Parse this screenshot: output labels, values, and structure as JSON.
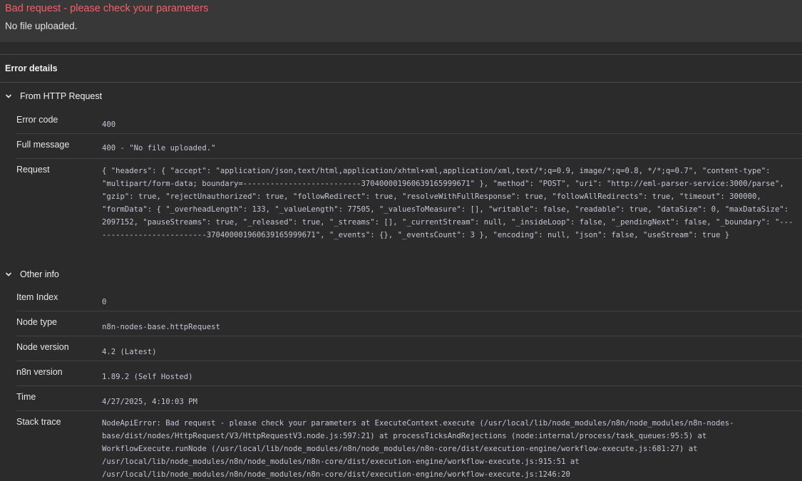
{
  "error": {
    "title": "Bad request - please check your parameters",
    "description": "No file uploaded."
  },
  "details": {
    "heading": "Error details",
    "sections": [
      {
        "title": "From HTTP Request",
        "rows": [
          {
            "label": "Error code",
            "value": "400"
          },
          {
            "label": "Full message",
            "value": "400 - \"No file uploaded.\""
          },
          {
            "label": "Request",
            "value": "{ \"headers\": { \"accept\": \"application/json,text/html,application/xhtml+xml,application/xml,text/*;q=0.9, image/*;q=0.8, */*;q=0.7\", \"content-type\": \"multipart/form-data; boundary=--------------------------370400001960639165999671\" }, \"method\": \"POST\", \"uri\": \"http://eml-parser-service:3000/parse\", \"gzip\": true, \"rejectUnauthorized\": true, \"followRedirect\": true, \"resolveWithFullResponse\": true, \"followAllRedirects\": true, \"timeout\": 300000, \"formData\": { \"_overheadLength\": 133, \"_valueLength\": 77505, \"_valuesToMeasure\": [], \"writable\": false, \"readable\": true, \"dataSize\": 0, \"maxDataSize\": 2097152, \"pauseStreams\": true, \"_released\": true, \"_streams\": [], \"_currentStream\": null, \"_insideLoop\": false, \"_pendingNext\": false, \"_boundary\": \"--------------------------370400001960639165999671\", \"_events\": {}, \"_eventsCount\": 3 }, \"encoding\": null, \"json\": false, \"useStream\": true }"
          }
        ]
      },
      {
        "title": "Other info",
        "rows": [
          {
            "label": "Item Index",
            "value": "0"
          },
          {
            "label": "Node type",
            "value": "n8n-nodes-base.httpRequest"
          },
          {
            "label": "Node version",
            "value": "4.2 (Latest)"
          },
          {
            "label": "n8n version",
            "value": "1.89.2 (Self Hosted)"
          },
          {
            "label": "Time",
            "value": "4/27/2025, 4:10:03 PM"
          },
          {
            "label": "Stack trace",
            "value": "NodeApiError: Bad request - please check your parameters at ExecuteContext.execute (/usr/local/lib/node_modules/n8n/node_modules/n8n-nodes-base/dist/nodes/HttpRequest/V3/HttpRequestV3.node.js:597:21) at processTicksAndRejections (node:internal/process/task_queues:95:5) at WorkflowExecute.runNode (/usr/local/lib/node_modules/n8n/node_modules/n8n-core/dist/execution-engine/workflow-execute.js:681:27) at /usr/local/lib/node_modules/n8n/node_modules/n8n-core/dist/execution-engine/workflow-execute.js:915:51 at /usr/local/lib/node_modules/n8n/node_modules/n8n-core/dist/execution-engine/workflow-execute.js:1246:20"
          }
        ]
      }
    ]
  }
}
